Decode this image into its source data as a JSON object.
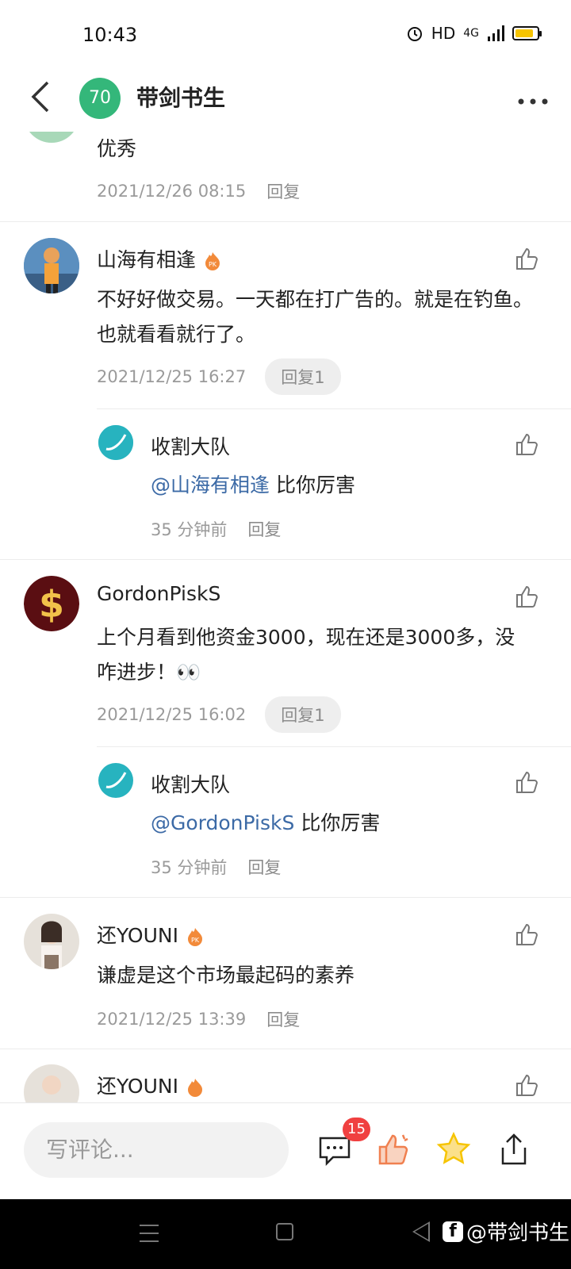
{
  "status_bar": {
    "time": "10:43",
    "hd": "HD",
    "network": "4G"
  },
  "header": {
    "level": "70",
    "title": "带剑书生"
  },
  "comments": [
    {
      "body": "优秀",
      "date": "2021/12/26 08:15",
      "reply_label": "回复"
    },
    {
      "name": "山海有相逢",
      "body": "不好好做交易。一天都在打广告的。就是在钓鱼。也就看看就行了。",
      "date": "2021/12/25 16:27",
      "reply_label": "回复1",
      "sub": {
        "name": "收割大队",
        "mention": "@山海有相逢",
        "body": " 比你厉害",
        "time": "35 分钟前",
        "reply_label": "回复"
      }
    },
    {
      "name": "GordonPiskS",
      "body": "上个月看到他资金3000，现在还是3000多，没咋进步！👀",
      "date": "2021/12/25 16:02",
      "reply_label": "回复1",
      "sub": {
        "name": "收割大队",
        "mention": "@GordonPiskS",
        "body": " 比你厉害",
        "time": "35 分钟前",
        "reply_label": "回复"
      }
    },
    {
      "name": "还YOUNI",
      "body": "谦虚是这个市场最起码的素养",
      "date": "2021/12/25 13:39",
      "reply_label": "回复"
    },
    {
      "name": "还YOUNI"
    }
  ],
  "bottom_bar": {
    "placeholder": "写评论...",
    "comment_count": "15"
  },
  "watermark": "@带剑书生",
  "colors": {
    "accent_green": "#34b77a",
    "mention": "#3c6aa6",
    "badge": "#f04040",
    "star": "#f6c400",
    "like_orange": "#f08050"
  }
}
